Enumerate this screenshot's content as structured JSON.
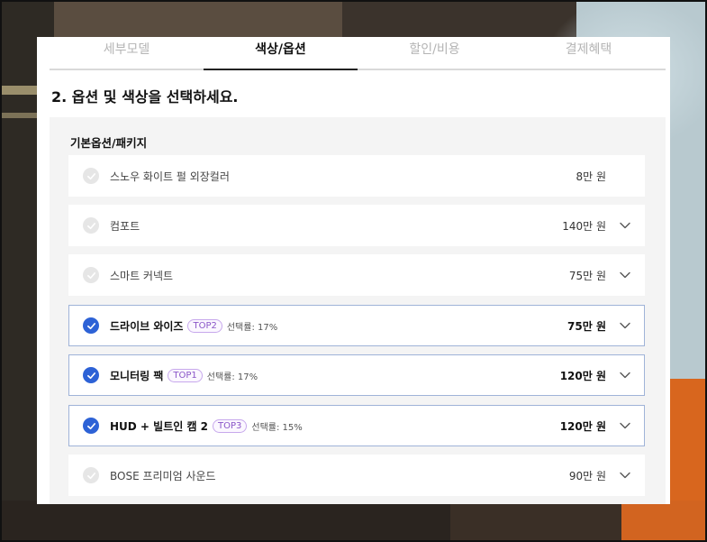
{
  "tabs": [
    {
      "label": "세부모델",
      "active": false
    },
    {
      "label": "색상/옵션",
      "active": true
    },
    {
      "label": "할인/비용",
      "active": false
    },
    {
      "label": "결제혜택",
      "active": false
    }
  ],
  "section_title": "2. 옵션 및 색상을 선택하세요.",
  "group_title": "기본옵션/패키지",
  "options": [
    {
      "label": "스노우 화이트 펄 외장컬러",
      "price": "8만 원",
      "selected": false,
      "expandable": false
    },
    {
      "label": "컴포트",
      "price": "140만 원",
      "selected": false,
      "expandable": true
    },
    {
      "label": "스마트 커넥트",
      "price": "75만 원",
      "selected": false,
      "expandable": true
    },
    {
      "label": "드라이브 와이즈",
      "badge": "TOP2",
      "rate": "선택률: 17%",
      "price": "75만 원",
      "selected": true,
      "expandable": true
    },
    {
      "label": "모니터링 팩",
      "badge": "TOP1",
      "rate": "선택률: 17%",
      "price": "120만 원",
      "selected": true,
      "expandable": true
    },
    {
      "label": "HUD + 빌트인 캠 2",
      "badge": "TOP3",
      "rate": "선택률: 15%",
      "price": "120만 원",
      "selected": true,
      "expandable": true
    },
    {
      "label": "BOSE 프리미엄 사운드",
      "price": "90만 원",
      "selected": false,
      "expandable": true
    }
  ],
  "colors": {
    "check_selected": "#2d62d6",
    "check_unselected": "#e6e6e6",
    "badge_purple": "#8a56c8",
    "selected_border": "#9fb3d8"
  }
}
